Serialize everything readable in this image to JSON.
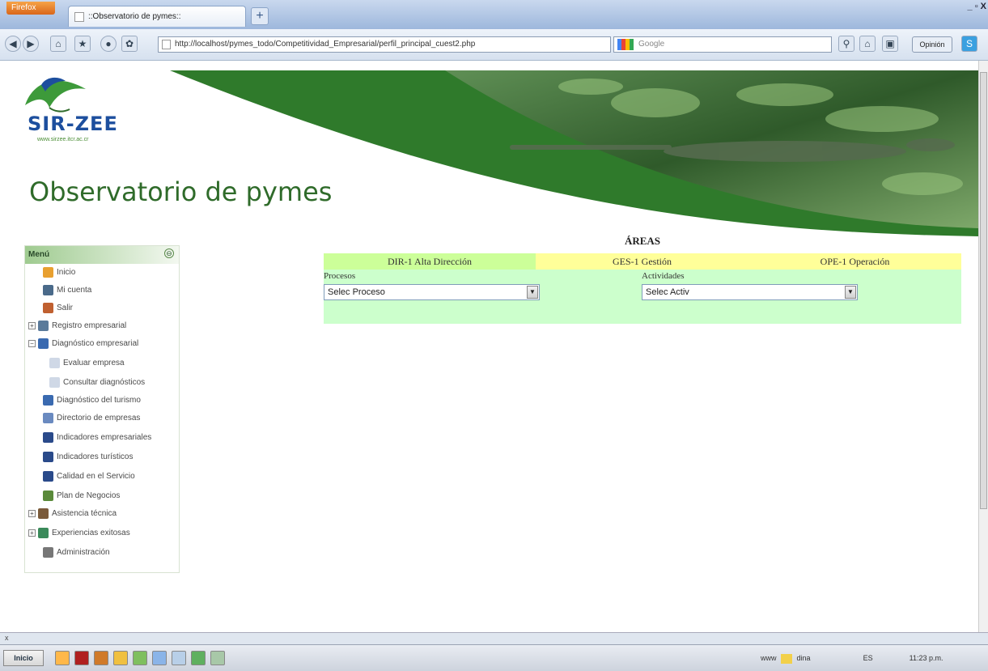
{
  "browser": {
    "app_button": "Firefox",
    "tab_title": "::Observatorio de pymes::",
    "new_tab": "+",
    "window_controls": "_ ▫ X",
    "url": "http://localhost/pymes_todo/Competitividad_Empresarial/perfil_principal_cuest2.php",
    "search_placeholder": "Google",
    "opinion_button": "Opinión"
  },
  "header": {
    "logo_text": "SIR-ZEE",
    "logo_url": "www.sirzee.itcr.ac.cr",
    "site_title": "Observatorio de pymes"
  },
  "menu": {
    "title": "Menú",
    "toggle": "⊖",
    "items": [
      {
        "label": "Inicio",
        "icon": "home-icon"
      },
      {
        "label": "Mi cuenta",
        "icon": "user-icon"
      },
      {
        "label": "Salir",
        "icon": "exit-icon"
      },
      {
        "label": "Registro empresarial",
        "icon": "register-icon",
        "expander": "+"
      },
      {
        "label": "Diagnóstico empresarial",
        "icon": "diagnosis-icon",
        "expander": "−"
      },
      {
        "label": "Evaluar empresa",
        "icon": "document-icon"
      },
      {
        "label": "Consultar diagnósticos",
        "icon": "document-icon"
      },
      {
        "label": "Diagnóstico del turismo",
        "icon": "diagnosis-icon"
      },
      {
        "label": "Directorio de empresas",
        "icon": "directory-icon"
      },
      {
        "label": "Indicadores empresariales",
        "icon": "books-icon"
      },
      {
        "label": "Indicadores turísticos",
        "icon": "books-icon"
      },
      {
        "label": "Calidad en el Servicio",
        "icon": "books-icon"
      },
      {
        "label": "Plan de Negocios",
        "icon": "plan-icon"
      },
      {
        "label": "Asistencia técnica",
        "icon": "assistance-icon",
        "expander": "+"
      },
      {
        "label": "Experiencias exitosas",
        "icon": "success-icon",
        "expander": "+"
      },
      {
        "label": "Administración",
        "icon": "admin-icon"
      }
    ]
  },
  "areas": {
    "title": "ÁREAS",
    "tabs": [
      {
        "label": "DIR-1 Alta Dirección",
        "color": "#ccff99"
      },
      {
        "label": "GES-1 Gestión",
        "color": "#ffff99"
      },
      {
        "label": "OPE-1 Operación",
        "color": "#ffff99"
      }
    ],
    "procesos_label": "Procesos",
    "procesos_value": "Selec Proceso",
    "actividades_label": "Actividades",
    "actividades_value": "Selec Activ",
    "panel_color": "#ccffcc"
  },
  "status": {
    "left": "x",
    "tray_lang": "ES",
    "clock": "11:23 p.m.",
    "tray_text": "www",
    "tray_user": "dina"
  },
  "taskbar": {
    "start_label": "Inicio"
  },
  "colors": {
    "brand_green": "#2f6b2a",
    "logo_blue": "#1d4f9e"
  }
}
